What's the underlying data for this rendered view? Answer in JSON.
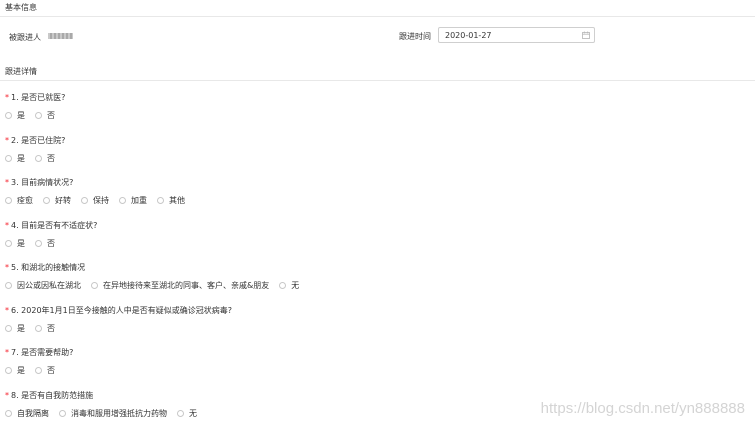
{
  "basic_info": {
    "title": "基本信息",
    "followed_person_label": "被跟进人",
    "follow_time_label": "跟进时间",
    "follow_time_value": "2020-01-27"
  },
  "details": {
    "title": "跟进详情",
    "required_mark": "*",
    "questions": [
      {
        "label": "1. 是否已就医?",
        "options": [
          "是",
          "否"
        ]
      },
      {
        "label": "2. 是否已住院?",
        "options": [
          "是",
          "否"
        ]
      },
      {
        "label": "3. 目前病情状况?",
        "options": [
          "痊愈",
          "好转",
          "保持",
          "加重",
          "其他"
        ]
      },
      {
        "label": "4. 目前是否有不适症状?",
        "options": [
          "是",
          "否"
        ]
      },
      {
        "label": "5. 和湖北的接触情况",
        "options": [
          "因公或因私在湖北",
          "在异地接待来至湖北的同事、客户、亲戚&朋友",
          "无"
        ]
      },
      {
        "label": "6. 2020年1月1日至今接触的人中是否有疑似或确诊冠状病毒?",
        "options": [
          "是",
          "否"
        ]
      },
      {
        "label": "7. 是否需要帮助?",
        "options": [
          "是",
          "否"
        ]
      },
      {
        "label": "8. 是否有自我防范措施",
        "options": [
          "自我隔离",
          "消毒和服用增强抵抗力药物",
          "无"
        ]
      }
    ]
  },
  "watermark": "https://blog.csdn.net/yn888888",
  "colors": {
    "required": "#f5222d",
    "border": "#cfcfcf",
    "divider": "#e8e8e8"
  }
}
